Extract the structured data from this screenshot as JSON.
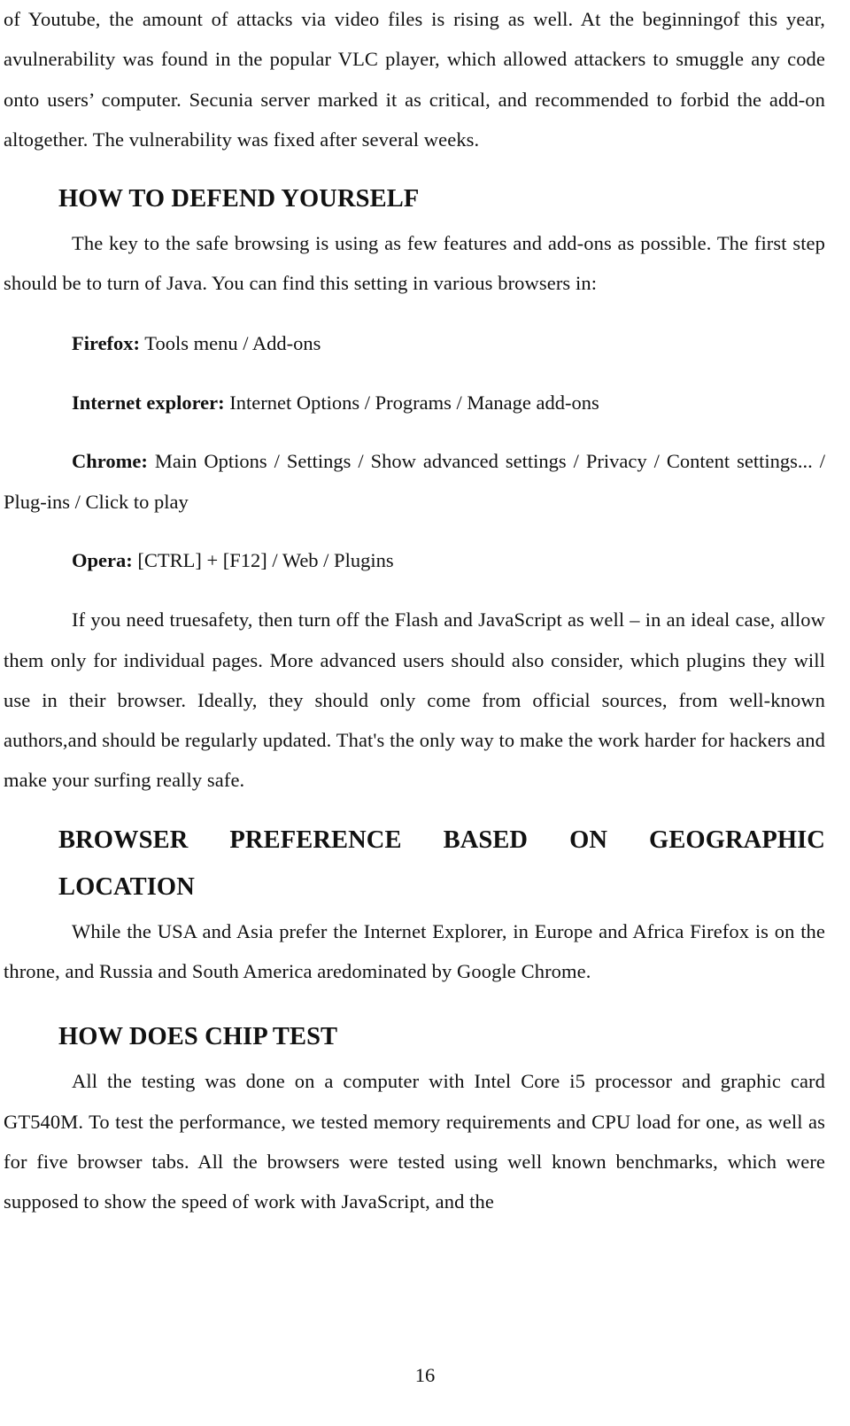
{
  "document": {
    "continued_paragraph": "of Youtube, the amount of attacks via video files is rising as well. At the beginningof this year, avulnerability was found in the popular VLC player, which allowed attackers to smuggle any code onto users’ computer. Secunia server marked it as critical, and recommended to forbid the add-on altogether. The vulnerability was fixed after several weeks.",
    "sections": [
      {
        "heading": "HOW TO DEFEND YOURSELF",
        "intro": "The key to the safe browsing is using as few features and add-ons as possible. The first step should be to turn of Java. You can find this setting in various browsers in:",
        "browser_settings": [
          {
            "browser": "Firefox:",
            "path": "Tools menu / Add-ons"
          },
          {
            "browser": "Internet explorer:",
            "path": "Internet Options / Programs / Manage add-ons"
          },
          {
            "browser": "Chrome:",
            "path": "Main Options / Settings / Show advanced settings / Privacy / Content settings... / Plug-ins / Click to play"
          },
          {
            "browser": "Opera:",
            "path": "[CTRL] + [F12] / Web / Plugins"
          }
        ],
        "closing": "If you need truesafety, then turn off the Flash and JavaScript as well – in an ideal case, allow them only for individual pages. More advanced users should also consider, which plugins they will use in their browser. Ideally, they should only come from official sources, from well-known authors,and should be regularly updated. That's the only way to make the work harder for hackers and make your surfing really safe."
      },
      {
        "heading_line1": "BROWSER PREFERENCE BASED ON GEOGRAPHIC",
        "heading_line2": "LOCATION",
        "body": "While the USA and Asia prefer the Internet Explorer, in Europe and Africa Firefox is on the throne, and Russia and South America aredominated by Google Chrome."
      },
      {
        "heading": "HOW DOES CHIP TEST",
        "body": "All the testing was done on a computer with Intel Core i5 processor and graphic card GT540M. To test the performance, we tested memory requirements and CPU load for one, as well as for five browser tabs. All the browsers were tested using well known benchmarks, which were supposed to show the speed of work with JavaScript, and the"
      }
    ],
    "page_number": "16"
  }
}
